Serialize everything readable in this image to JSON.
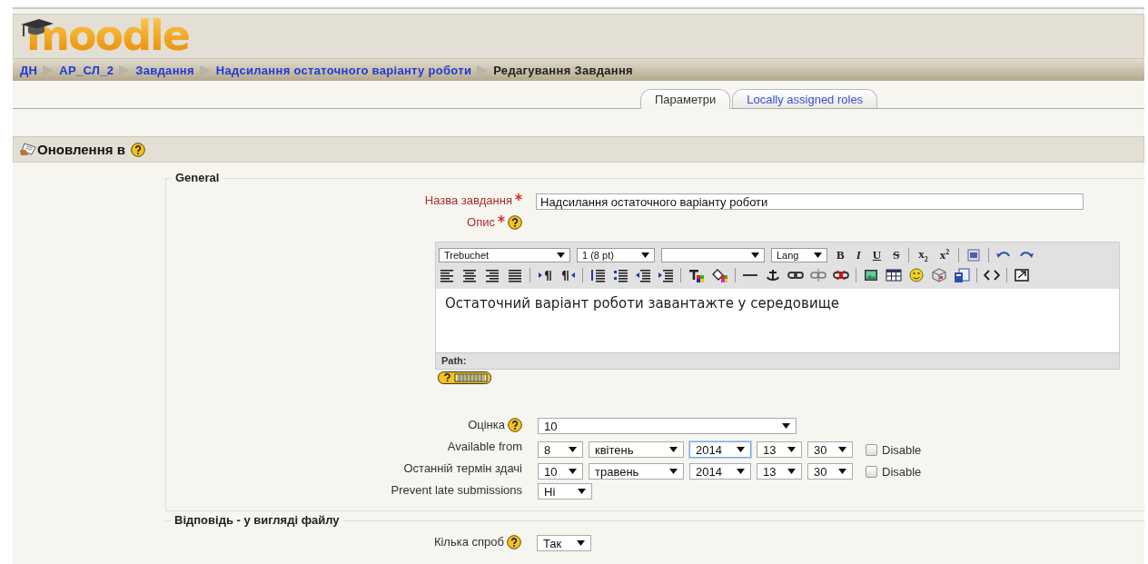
{
  "logo": {
    "text": "moodle"
  },
  "breadcrumb": [
    {
      "label": "ДН",
      "link": true
    },
    {
      "label": "АР_СЛ_2",
      "link": true
    },
    {
      "label": "Завдання",
      "link": true
    },
    {
      "label": "Надсилання остаточного варіанту роботи",
      "link": true
    },
    {
      "label": "Редагування Завдання",
      "link": false
    }
  ],
  "tabs": [
    {
      "label": "Параметри",
      "selected": true
    },
    {
      "label": "Locally assigned roles",
      "selected": false
    }
  ],
  "heading": {
    "title": "Оновлення в",
    "help": true
  },
  "sections": [
    {
      "legend": "General",
      "rows": [
        {
          "kind": "text",
          "label": "Назва завдання",
          "required": true,
          "help": false,
          "value": "Надсилання остаточного варіанту роботи"
        },
        {
          "kind": "editor",
          "label": "Опис",
          "required": true,
          "help": true,
          "content": "Остаточний варіант роботи завантажте у середовище",
          "path_label": "Path:",
          "toolbar": [
            [
              {
                "kind": "select",
                "value": "Trebuchet"
              },
              {
                "kind": "select",
                "value": "1 (8 pt)"
              },
              {
                "kind": "select"
              },
              {
                "kind": "select",
                "value": "Lang"
              },
              {
                "kind": "char",
                "label": "B"
              },
              {
                "kind": "char",
                "label": "I"
              },
              {
                "kind": "char",
                "label": "U"
              },
              {
                "kind": "char",
                "label": "S"
              },
              {
                "kind": "sep"
              },
              {
                "kind": "char",
                "label": "x$_{2}$"
              },
              {
                "kind": "char",
                "label": "x$^{2}$"
              },
              {
                "kind": "sep"
              },
              {
                "kind": "icon"
              },
              {
                "kind": "sep"
              },
              {
                "kind": "icon"
              },
              {
                "kind": "icon"
              }
            ],
            [
              {
                "kind": "icon"
              },
              {
                "kind": "icon"
              },
              {
                "kind": "icon"
              },
              {
                "kind": "icon"
              },
              {
                "kind": "sep"
              },
              {
                "kind": "icon"
              },
              {
                "kind": "icon"
              },
              {
                "kind": "sep"
              },
              {
                "kind": "icon"
              },
              {
                "kind": "icon"
              },
              {
                "kind": "icon"
              },
              {
                "kind": "icon"
              },
              {
                "kind": "sep"
              },
              {
                "kind": "icon"
              },
              {
                "kind": "icon"
              },
              {
                "kind": "sep"
              },
              {
                "kind": "icon"
              },
              {
                "kind": "icon"
              },
              {
                "kind": "icon"
              },
              {
                "kind": "icon"
              },
              {
                "kind": "icon"
              },
              {
                "kind": "sep"
              },
              {
                "kind": "icon"
              },
              {
                "kind": "icon"
              },
              {
                "kind": "icon"
              },
              {
                "kind": "icon"
              },
              {
                "kind": "icon"
              },
              {
                "kind": "sep"
              },
              {
                "kind": "icon"
              },
              {
                "kind": "sep"
              },
              {
                "kind": "icon"
              }
            ]
          ]
        },
        {
          "kind": "menu",
          "label": "Оцінка",
          "required": false,
          "help": true,
          "value": "10"
        },
        {
          "kind": "datetime",
          "label": "Available from",
          "required": false,
          "help": false,
          "fields": [
            {
              "value": "8",
              "focused": false
            },
            {
              "value": "квітень",
              "focused": false
            },
            {
              "value": "2014",
              "focused": true
            },
            {
              "value": "13",
              "focused": false
            },
            {
              "value": "30",
              "focused": false
            }
          ],
          "disable": {
            "label": "Disable",
            "checked": false
          }
        },
        {
          "kind": "datetime",
          "label": "Останній термін здачі",
          "required": false,
          "help": false,
          "fields": [
            {
              "value": "10",
              "focused": false
            },
            {
              "value": "травень",
              "focused": false
            },
            {
              "value": "2014",
              "focused": false
            },
            {
              "value": "13",
              "focused": false
            },
            {
              "value": "30",
              "focused": false
            }
          ],
          "disable": {
            "label": "Disable",
            "checked": false
          }
        },
        {
          "kind": "select",
          "label": "Prevent late submissions",
          "required": false,
          "help": false,
          "value": "Ні"
        }
      ]
    },
    {
      "legend": "Відповідь - у вигляді файлу",
      "rows": [
        {
          "kind": "select",
          "label": "Кілька спроб",
          "required": false,
          "help": true,
          "value": "Так"
        }
      ]
    }
  ]
}
